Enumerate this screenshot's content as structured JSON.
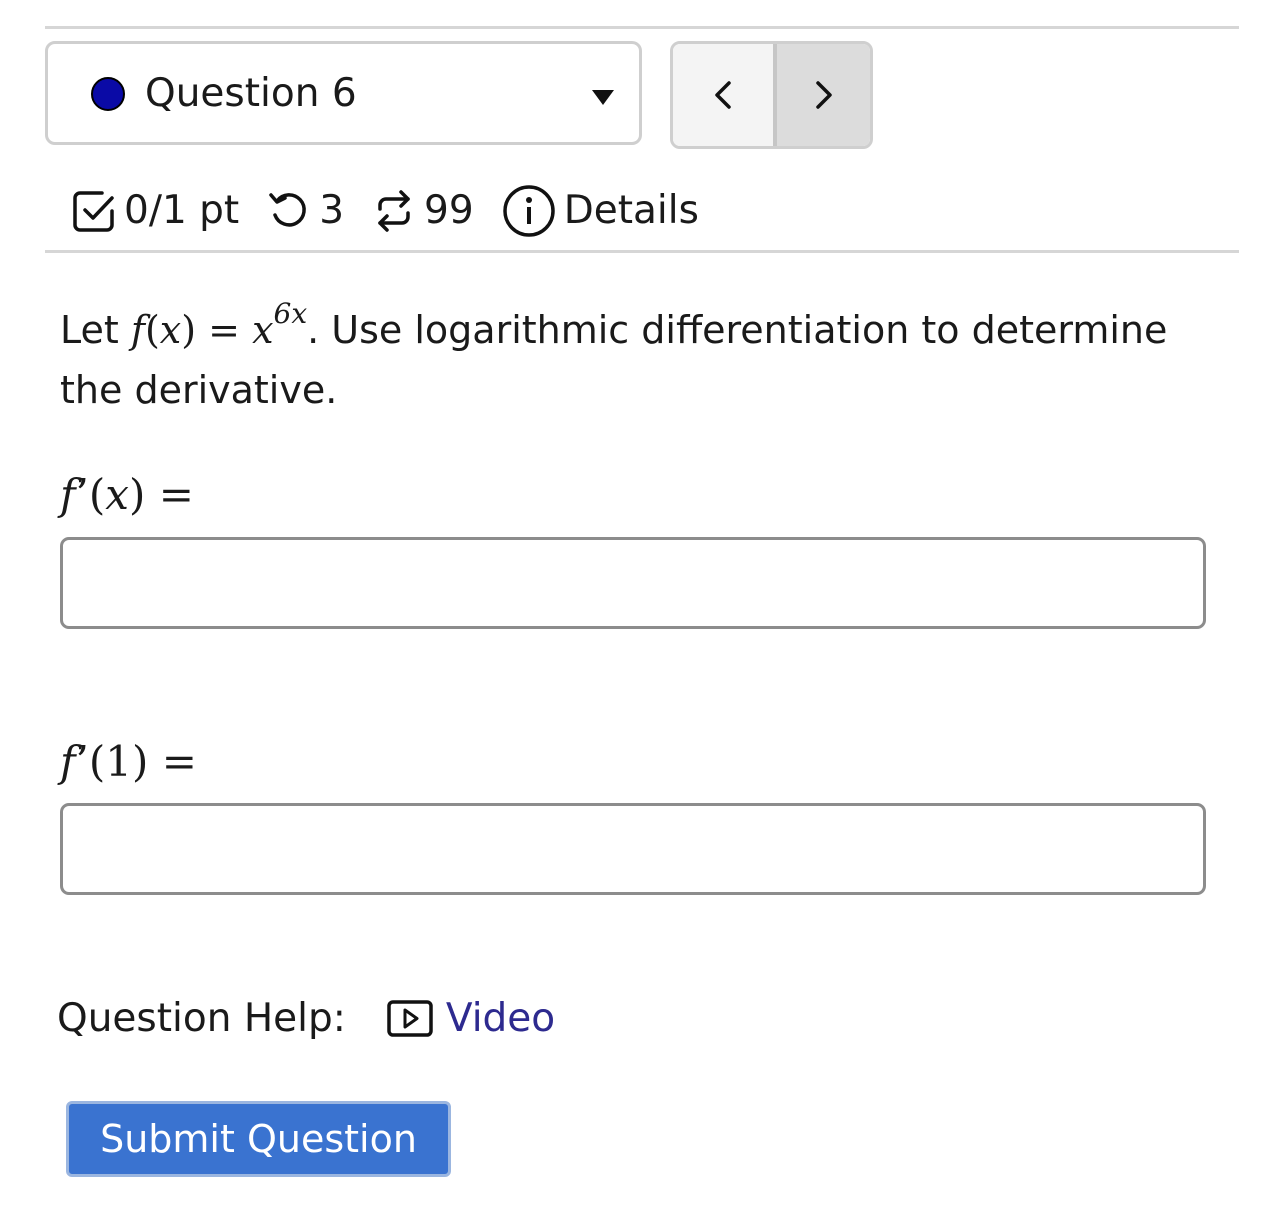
{
  "question_selector": {
    "label": "Question 6",
    "status_color": "#0a0aa6"
  },
  "nav": {
    "prev_icon": "chevron-left-icon",
    "next_icon": "chevron-right-icon"
  },
  "meta": {
    "score": "0/1 pt",
    "retries": "3",
    "submissions": "99",
    "details_label": "Details"
  },
  "question": {
    "intro": "Let ",
    "f_name": "f",
    "f_arg": "x",
    "equals": "=",
    "base": "x",
    "exponent": "6x",
    "tail": ". Use logarithmic differentiation to determine the derivative."
  },
  "parts": [
    {
      "label_fn": "f",
      "label_prime": "’",
      "label_arg": "x",
      "label_eq": "=",
      "value": ""
    },
    {
      "label_fn": "f",
      "label_prime": "’",
      "label_arg": "1",
      "label_eq": "=",
      "value": ""
    }
  ],
  "help": {
    "label": "Question Help:",
    "video_label": "Video"
  },
  "submit_label": "Submit Question",
  "colors": {
    "submit_bg": "#3a73d0",
    "link": "#2d2a8f"
  }
}
